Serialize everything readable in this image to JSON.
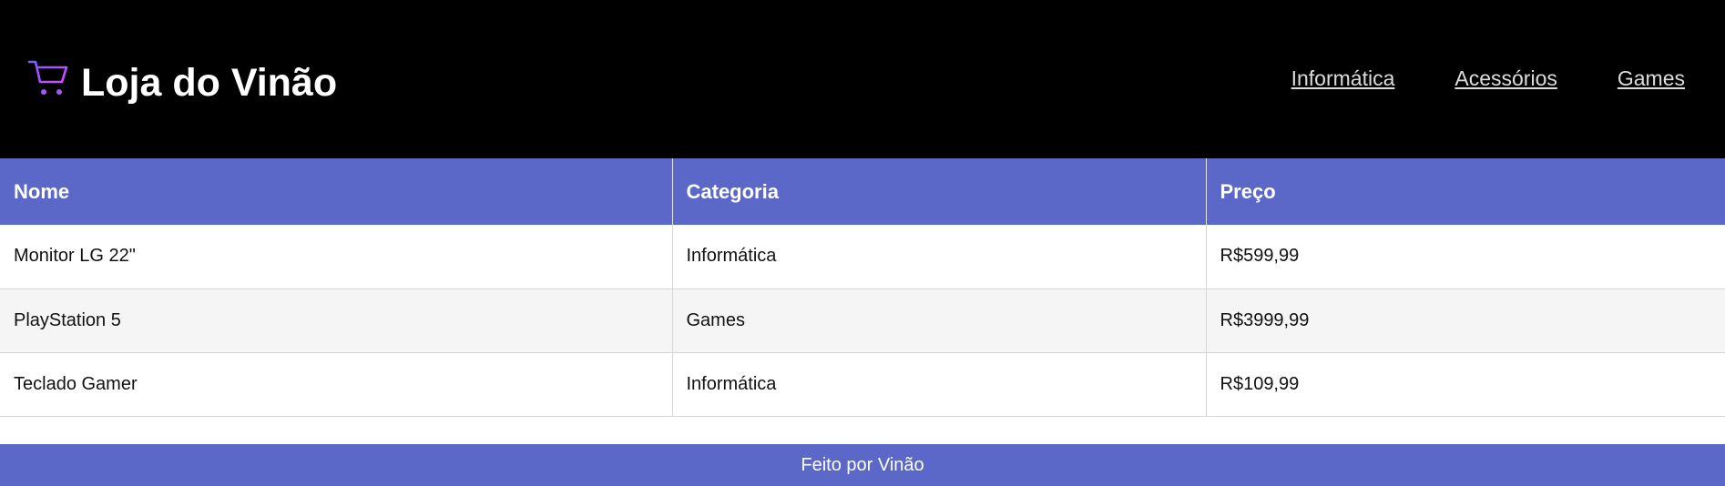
{
  "header": {
    "brand": "Loja do Vinão",
    "logo_icon": "shopping-cart-icon",
    "nav": [
      {
        "label": "Informática"
      },
      {
        "label": "Acessórios"
      },
      {
        "label": "Games"
      }
    ]
  },
  "table": {
    "columns": [
      "Nome",
      "Categoria",
      "Preço"
    ],
    "rows": [
      [
        "Monitor LG 22\"",
        "Informática",
        "R$599,99"
      ],
      [
        "PlayStation 5",
        "Games",
        "R$3999,99"
      ],
      [
        "Teclado Gamer",
        "Informática",
        "R$109,99"
      ]
    ]
  },
  "footer": {
    "text": "Feito por Vinão"
  },
  "colors": {
    "header_bg": "#000000",
    "accent": "#5b68c7",
    "icon_gradient_start": "#7b5cff",
    "icon_gradient_end": "#d24cff"
  }
}
